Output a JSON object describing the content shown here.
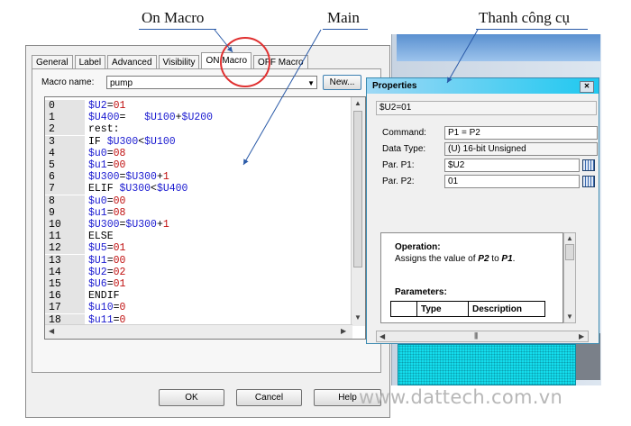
{
  "annotations": {
    "on_macro": "On Macro",
    "main": "Main",
    "toolbar": "Thanh công cụ"
  },
  "tabs": [
    "General",
    "Label",
    "Advanced",
    "Visibility",
    "ON Macro",
    "OFF Macro"
  ],
  "active_tab": "ON Macro",
  "macro_name": {
    "label": "Macro name:",
    "value": "pump",
    "new_button": "New..."
  },
  "code_lines": [
    {
      "n": "0",
      "parts": [
        [
          "v",
          "$U2"
        ],
        [
          "k",
          "="
        ],
        [
          "d",
          "01"
        ]
      ]
    },
    {
      "n": "1",
      "parts": [
        [
          "v",
          "$U400"
        ],
        [
          "k",
          "=   "
        ],
        [
          "v",
          "$U100"
        ],
        [
          "k",
          "+"
        ],
        [
          "v",
          "$U200"
        ]
      ]
    },
    {
      "n": "2",
      "parts": [
        [
          "k",
          "rest:"
        ]
      ]
    },
    {
      "n": "3",
      "parts": [
        [
          "k",
          "IF "
        ],
        [
          "v",
          "$U300"
        ],
        [
          "k",
          "<"
        ],
        [
          "v",
          "$U100"
        ]
      ]
    },
    {
      "n": "4",
      "parts": [
        [
          "v",
          "$u0"
        ],
        [
          "k",
          "="
        ],
        [
          "d",
          "08"
        ]
      ]
    },
    {
      "n": "5",
      "parts": [
        [
          "v",
          "$u1"
        ],
        [
          "k",
          "="
        ],
        [
          "d",
          "00"
        ]
      ]
    },
    {
      "n": "6",
      "parts": [
        [
          "v",
          "$U300"
        ],
        [
          "k",
          "="
        ],
        [
          "v",
          "$U300"
        ],
        [
          "k",
          "+"
        ],
        [
          "d",
          "1"
        ]
      ]
    },
    {
      "n": "7",
      "parts": [
        [
          "k",
          "ELIF "
        ],
        [
          "v",
          "$U300"
        ],
        [
          "k",
          "<"
        ],
        [
          "v",
          "$U400"
        ]
      ]
    },
    {
      "n": "8",
      "parts": [
        [
          "v",
          "$u0"
        ],
        [
          "k",
          "="
        ],
        [
          "d",
          "00"
        ]
      ]
    },
    {
      "n": "9",
      "parts": [
        [
          "v",
          "$u1"
        ],
        [
          "k",
          "="
        ],
        [
          "d",
          "08"
        ]
      ]
    },
    {
      "n": "10",
      "parts": [
        [
          "v",
          "$U300"
        ],
        [
          "k",
          "="
        ],
        [
          "v",
          "$U300"
        ],
        [
          "k",
          "+"
        ],
        [
          "d",
          "1"
        ]
      ]
    },
    {
      "n": "11",
      "parts": [
        [
          "k",
          "ELSE"
        ]
      ]
    },
    {
      "n": "12",
      "parts": [
        [
          "v",
          "$U5"
        ],
        [
          "k",
          "="
        ],
        [
          "d",
          "01"
        ]
      ]
    },
    {
      "n": "13",
      "parts": [
        [
          "v",
          "$U1"
        ],
        [
          "k",
          "="
        ],
        [
          "d",
          "00"
        ]
      ]
    },
    {
      "n": "14",
      "parts": [
        [
          "v",
          "$U2"
        ],
        [
          "k",
          "="
        ],
        [
          "d",
          "02"
        ]
      ]
    },
    {
      "n": "15",
      "parts": [
        [
          "v",
          "$U6"
        ],
        [
          "k",
          "="
        ],
        [
          "d",
          "01"
        ]
      ]
    },
    {
      "n": "16",
      "parts": [
        [
          "k",
          "ENDIF"
        ]
      ]
    },
    {
      "n": "17",
      "parts": [
        [
          "v",
          "$u10"
        ],
        [
          "k",
          "="
        ],
        [
          "d",
          "0"
        ]
      ]
    },
    {
      "n": "18",
      "parts": [
        [
          "v",
          "$u11"
        ],
        [
          "k",
          "="
        ],
        [
          "d",
          "0"
        ]
      ]
    }
  ],
  "buttons": {
    "ok": "OK",
    "cancel": "Cancel",
    "help": "Help"
  },
  "properties": {
    "title": "Properties",
    "selected": "$U2=01",
    "command_label": "Command:",
    "command_value": "P1 = P2",
    "datatype_label": "Data Type:",
    "datatype_value": "(U) 16-bit Unsigned",
    "p1_label": "Par. P1:",
    "p1_value": "$U2",
    "p2_label": "Par. P2:",
    "p2_value": "01",
    "help": {
      "operation_title": "Operation:",
      "operation_pre": "Assigns the value of ",
      "operation_p2": "P2",
      "operation_mid": " to ",
      "operation_p1": "P1",
      "operation_end": ".",
      "parameters_title": "Parameters:",
      "columns": [
        "Type",
        "Description"
      ]
    }
  },
  "watermark": "www.dattech.com.vn",
  "colors": {
    "variable": "#1a1ad0",
    "number": "#c01010",
    "title_bar": "#1ec8f0",
    "circle": "#e03030"
  }
}
